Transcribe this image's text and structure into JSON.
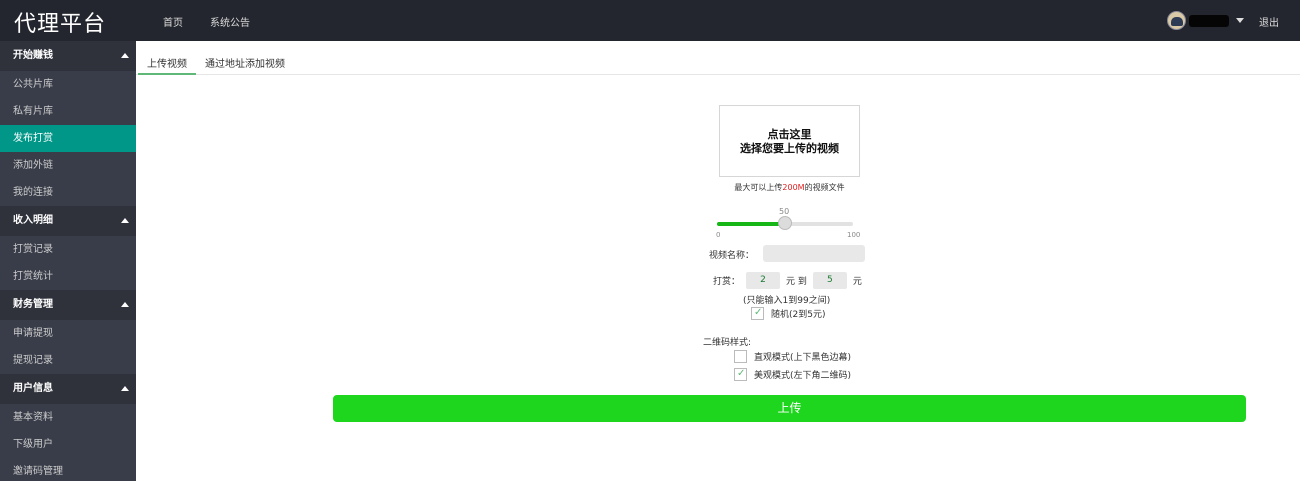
{
  "app": {
    "logo": "代理平台"
  },
  "topnav": {
    "items": [
      "首页",
      "系统公告"
    ],
    "logout": "退出"
  },
  "sidebar": {
    "groups": [
      {
        "title": "开始赚钱",
        "items": [
          "公共片库",
          "私有片库",
          "发布打赏",
          "添加外链",
          "我的连接"
        ]
      },
      {
        "title": "收入明细",
        "items": [
          "打赏记录",
          "打赏统计"
        ]
      },
      {
        "title": "财务管理",
        "items": [
          "申请提现",
          "提现记录"
        ]
      },
      {
        "title": "用户信息",
        "items": [
          "基本资料",
          "下级用户",
          "邀请码管理"
        ]
      }
    ],
    "active_item": "发布打赏"
  },
  "tabs": [
    "上传视频",
    "通过地址添加视频"
  ],
  "upload": {
    "dropzone_line1": "点击这里",
    "dropzone_line2": "选择您要上传的视频",
    "hint_prefix": "最大可以上传",
    "hint_size": "200M",
    "hint_suffix": "的视频文件"
  },
  "slider": {
    "value": "50",
    "min": "0",
    "max": "100"
  },
  "form": {
    "name_label": "视频名称：",
    "name_value": "",
    "reward_label": "打赏：",
    "min_value": "2",
    "unit_to": "元 到",
    "max_value": "5",
    "unit": "元",
    "range_note": "(只能输入1到99之间)",
    "random_label": "随机(2到5元)",
    "qr_style_label": "二维码样式:",
    "qr_option_1": "直观模式(上下黑色边幕)",
    "qr_option_2": "美观模式(左下角二维码)",
    "submit_label": "上传"
  },
  "colors": {
    "topbar": "#23262e",
    "sidebar": "#393d49",
    "active": "#009688",
    "button": "#1fd61f"
  }
}
